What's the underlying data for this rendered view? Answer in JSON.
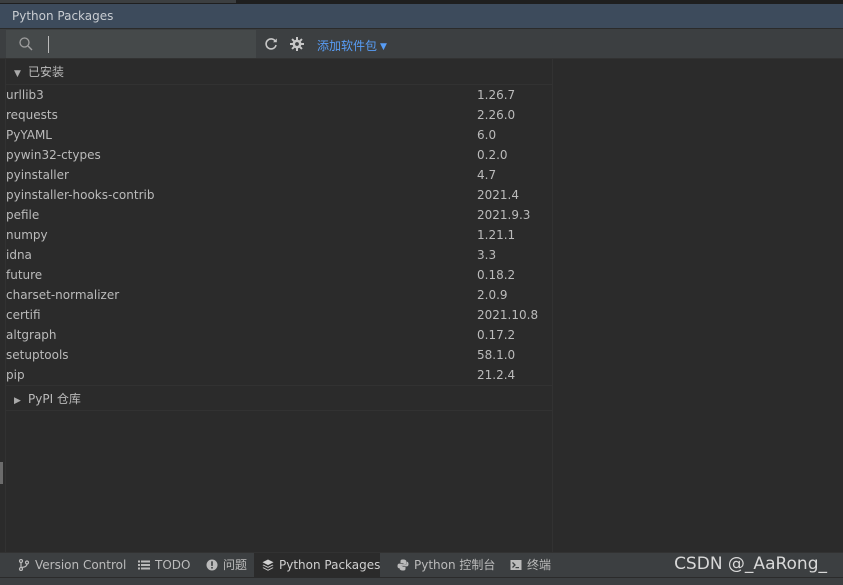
{
  "window": {
    "title": "Python Packages"
  },
  "toolbar": {
    "search_value": "",
    "search_placeholder": "",
    "add_package_label": "添加软件包"
  },
  "installed": {
    "label": "已安装",
    "packages": [
      {
        "name": "urllib3",
        "version": "1.26.7"
      },
      {
        "name": "requests",
        "version": "2.26.0"
      },
      {
        "name": "PyYAML",
        "version": "6.0"
      },
      {
        "name": "pywin32-ctypes",
        "version": "0.2.0"
      },
      {
        "name": "pyinstaller",
        "version": "4.7"
      },
      {
        "name": "pyinstaller-hooks-contrib",
        "version": "2021.4"
      },
      {
        "name": "pefile",
        "version": "2021.9.3"
      },
      {
        "name": "numpy",
        "version": "1.21.1"
      },
      {
        "name": "idna",
        "version": "3.3"
      },
      {
        "name": "future",
        "version": "0.18.2"
      },
      {
        "name": "charset-normalizer",
        "version": "2.0.9"
      },
      {
        "name": "certifi",
        "version": "2021.10.8"
      },
      {
        "name": "altgraph",
        "version": "0.17.2"
      },
      {
        "name": "setuptools",
        "version": "58.1.0"
      },
      {
        "name": "pip",
        "version": "21.2.4"
      }
    ]
  },
  "pypi": {
    "label": "PyPI 仓库"
  },
  "bottom_bar": {
    "items": [
      {
        "label": "Version Control",
        "icon": "branch-icon"
      },
      {
        "label": "TODO",
        "icon": "list-icon"
      },
      {
        "label": "问题",
        "icon": "info-icon"
      },
      {
        "label": "Python Packages",
        "icon": "layers-icon"
      },
      {
        "label": "Python 控制台",
        "icon": "python-icon"
      },
      {
        "label": "终端",
        "icon": "terminal-icon"
      }
    ],
    "watermark": "CSDN @_AaRong_"
  },
  "colors": {
    "link": "#589df6",
    "title_bar": "#3d4b5c",
    "toolbar": "#3c3f41",
    "background": "#2b2b2b"
  }
}
